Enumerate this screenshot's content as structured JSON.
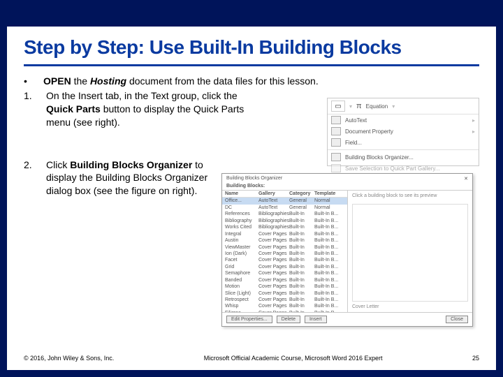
{
  "title": "Step by Step: Use Built-In Building Blocks",
  "bullet": {
    "pre": "OPEN",
    "mid": "Hosting",
    "post": "document from the data files for this lesson."
  },
  "steps": {
    "s1": {
      "num": "1.",
      "pre": "On the Insert tab, in the Text group, click the",
      "bold": "Quick Parts",
      "post": "button to display the Quick Parts menu (see right)."
    },
    "s2": {
      "num": "2.",
      "pre": "Click",
      "bold": "Building Blocks Organizer",
      "post": "to display the Building Blocks Organizer dialog box (see the figure on right)."
    }
  },
  "menu": {
    "equation": "Equation",
    "items": [
      "AutoText",
      "Document Property",
      "Field...",
      "Building Blocks Organizer...",
      "Save Selection to Quick Part Gallery..."
    ]
  },
  "dialog": {
    "title": "Building Blocks Organizer",
    "close": "✕",
    "subtitle": "Building Blocks:",
    "previewHint": "Click a building block to see its preview",
    "preview_caption": "Cover Letter",
    "head": [
      "Name",
      "Gallery",
      "Category",
      "Template"
    ],
    "rows": [
      [
        "Office...",
        "AutoText",
        "General",
        "Normal"
      ],
      [
        "DC",
        "AutoText",
        "General",
        "Normal"
      ],
      [
        "References",
        "Bibliographies",
        "Built-In",
        "Built-In B..."
      ],
      [
        "Bibliography",
        "Bibliographies",
        "Built-In",
        "Built-In B..."
      ],
      [
        "Works Cited",
        "Bibliographies",
        "Built-In",
        "Built-In B..."
      ],
      [
        "Integral",
        "Cover Pages",
        "Built-In",
        "Built-In B..."
      ],
      [
        "Austin",
        "Cover Pages",
        "Built-In",
        "Built-In B..."
      ],
      [
        "ViewMaster",
        "Cover Pages",
        "Built-In",
        "Built-In B..."
      ],
      [
        "Ion (Dark)",
        "Cover Pages",
        "Built-In",
        "Built-In B..."
      ],
      [
        "Facet",
        "Cover Pages",
        "Built-In",
        "Built-In B..."
      ],
      [
        "Grid",
        "Cover Pages",
        "Built-In",
        "Built-In B..."
      ],
      [
        "Semaphore",
        "Cover Pages",
        "Built-In",
        "Built-In B..."
      ],
      [
        "Banded",
        "Cover Pages",
        "Built-In",
        "Built-In B..."
      ],
      [
        "Motion",
        "Cover Pages",
        "Built-In",
        "Built-In B..."
      ],
      [
        "Slice (Light)",
        "Cover Pages",
        "Built-In",
        "Built-In B..."
      ],
      [
        "Retrospect",
        "Cover Pages",
        "Built-In",
        "Built-In B..."
      ],
      [
        "Whisp",
        "Cover Pages",
        "Built-In",
        "Built-In B..."
      ],
      [
        "Filigree",
        "Cover Pages",
        "Built-In",
        "Built-In B..."
      ]
    ],
    "buttons": {
      "edit": "Edit Properties...",
      "delete": "Delete",
      "insert": "Insert",
      "close": "Close"
    }
  },
  "footer": {
    "left": "© 2016, John Wiley & Sons, Inc.",
    "center": "Microsoft Official Academic Course, Microsoft Word 2016 Expert",
    "right": "25"
  }
}
